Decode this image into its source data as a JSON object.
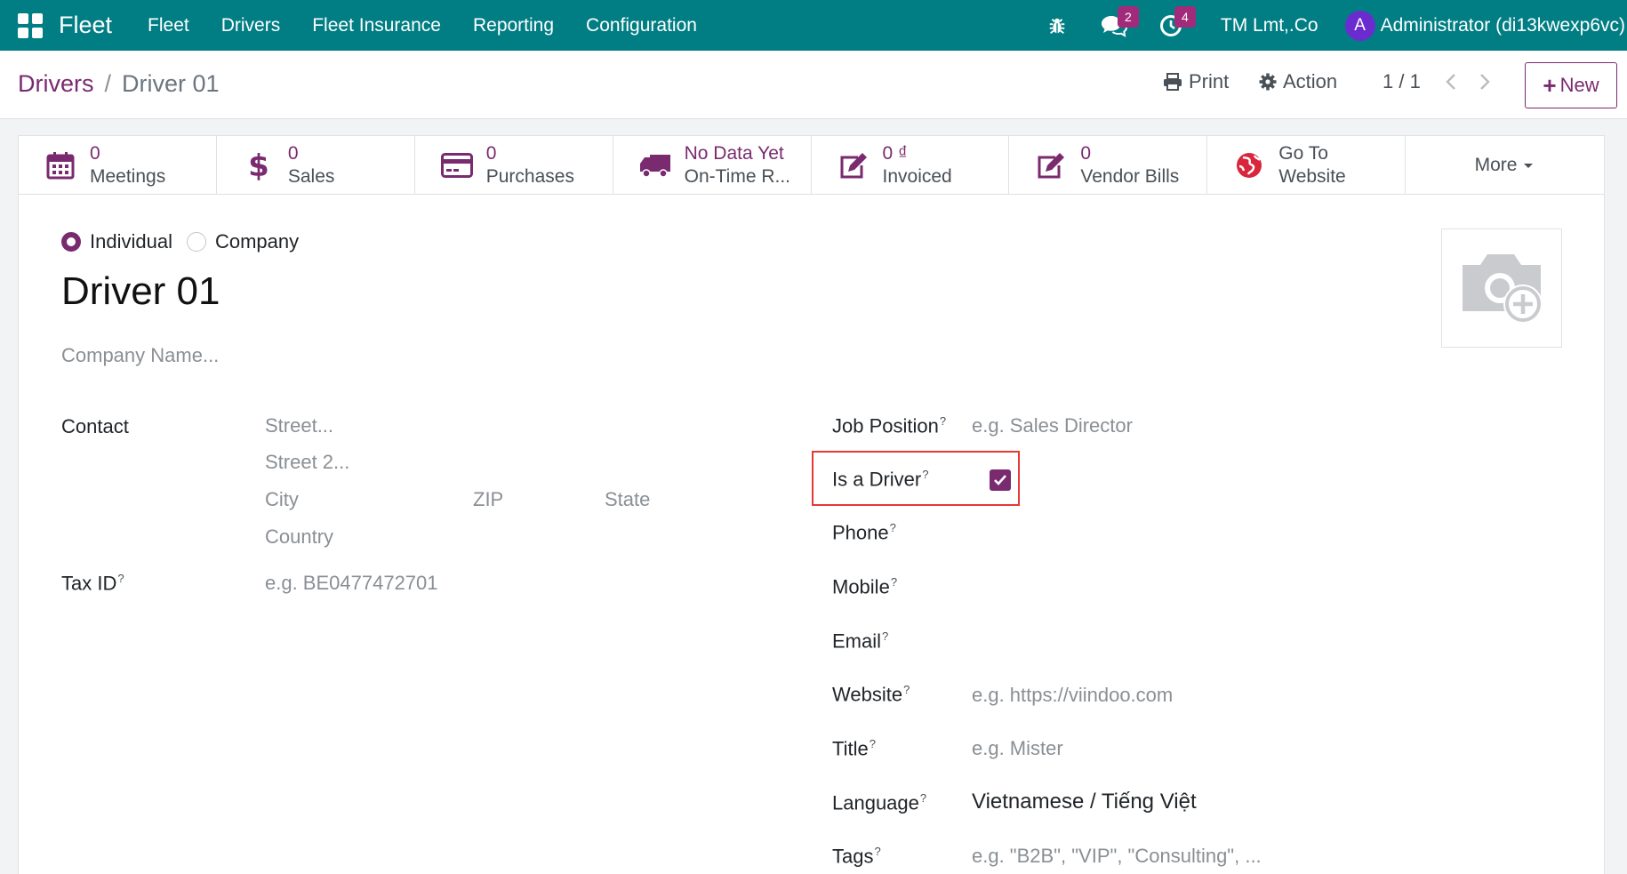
{
  "navbar": {
    "brand": "Fleet",
    "menu": [
      "Fleet",
      "Drivers",
      "Fleet Insurance",
      "Reporting",
      "Configuration"
    ],
    "messages_count": "2",
    "activities_count": "4",
    "company": "TM Lmt,.Co",
    "user_initial": "A",
    "user_name": "Administrator (di13kwexp6vc)"
  },
  "control_panel": {
    "breadcrumb_parent": "Drivers",
    "breadcrumb_separator": "/",
    "breadcrumb_current": "Driver 01",
    "print_label": "Print",
    "action_label": "Action",
    "pager": "1 / 1",
    "new_label": "New"
  },
  "smart_buttons": [
    {
      "value": "0",
      "label": "Meetings",
      "icon": "calendar-icon"
    },
    {
      "value": "0",
      "label": "Sales",
      "icon": "dollar-icon"
    },
    {
      "value": "0",
      "label": "Purchases",
      "icon": "credit-card-icon"
    },
    {
      "value": "No Data Yet",
      "label": "On-Time R...",
      "icon": "truck-icon"
    },
    {
      "value": "0 ₫",
      "label": "Invoiced",
      "icon": "edit-icon"
    },
    {
      "value": "0",
      "label": "Vendor Bills",
      "icon": "edit-icon"
    },
    {
      "value": "Go To",
      "label": "Website",
      "icon": "globe-icon"
    }
  ],
  "more_label": "More",
  "form": {
    "type_individual": "Individual",
    "type_company": "Company",
    "selected_type": "Individual",
    "name": "Driver 01",
    "company_name_placeholder": "Company Name...",
    "contact_label": "Contact",
    "street_placeholder": "Street...",
    "street2_placeholder": "Street 2...",
    "city_placeholder": "City",
    "zip_placeholder": "ZIP",
    "state_placeholder": "State",
    "country_placeholder": "Country",
    "tax_id_label": "Tax ID",
    "tax_id_placeholder": "e.g. BE0477472701",
    "help_mark": "?",
    "job_position_label": "Job Position",
    "job_position_placeholder": "e.g. Sales Director",
    "is_driver_label": "Is a Driver",
    "is_driver_checked": true,
    "phone_label": "Phone",
    "mobile_label": "Mobile",
    "email_label": "Email",
    "website_label": "Website",
    "website_placeholder": "e.g. https://viindoo.com",
    "title_label": "Title",
    "title_placeholder": "e.g. Mister",
    "language_label": "Language",
    "language_value": "Vietnamese / Tiếng Việt",
    "tags_label": "Tags",
    "tags_placeholder": "e.g. \"B2B\", \"VIP\", \"Consulting\", ..."
  },
  "colors": {
    "navbar": "#017e84",
    "primary": "#7a2a6f",
    "highlight": "#e53935"
  }
}
